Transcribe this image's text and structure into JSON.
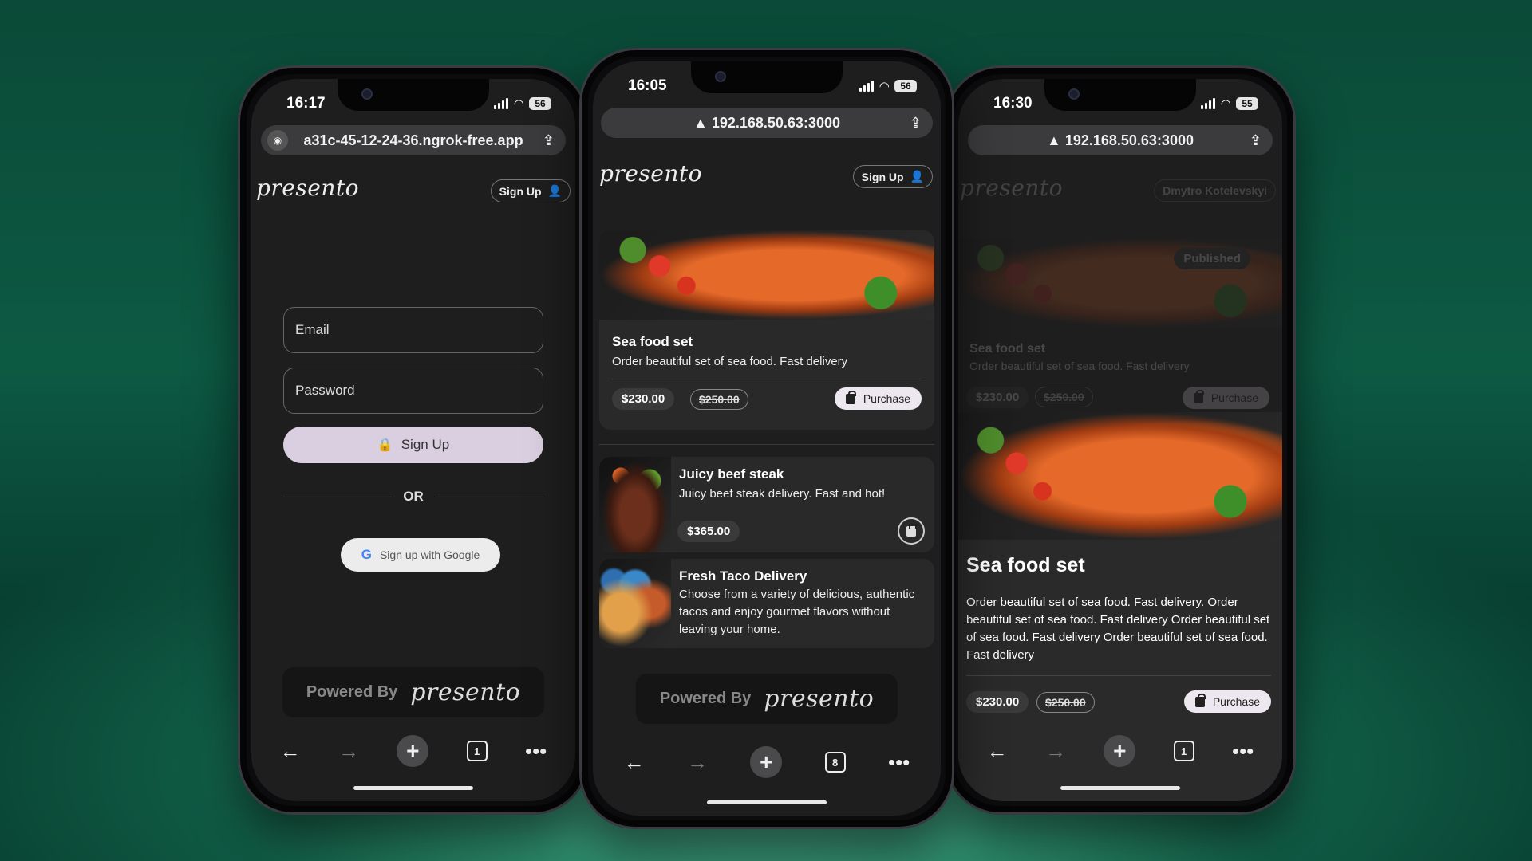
{
  "phone_left": {
    "status": {
      "time": "16:17",
      "battery": "56"
    },
    "url": "a31c-45-12-24-36.ngrok-free.app",
    "brand": "presento",
    "signup_top": "Sign Up",
    "email_placeholder": "Email",
    "password_placeholder": "Password",
    "signup_button": "Sign Up",
    "or_label": "OR",
    "google_button": "Sign up with Google",
    "powered_by": "Powered By",
    "powered_brand": "presento",
    "tab_count": "1"
  },
  "phone_center": {
    "status": {
      "time": "16:05",
      "battery": "56"
    },
    "url": "192.168.50.63:3000",
    "brand": "presento",
    "signup_top": "Sign Up",
    "featured": {
      "title": "Sea food set",
      "description": "Order beautiful set of sea food. Fast delivery",
      "price": "$230.00",
      "old_price": "$250.00",
      "purchase_label": "Purchase"
    },
    "items": [
      {
        "title": "Juicy beef steak",
        "description": "Juicy beef steak delivery. Fast and hot!",
        "price": "$365.00"
      },
      {
        "title": "Fresh Taco Delivery",
        "description": "Choose from a variety of delicious, authentic tacos and enjoy gourmet flavors without leaving your home."
      }
    ],
    "powered_by": "Powered By",
    "powered_brand": "presento",
    "tab_count": "8"
  },
  "phone_right": {
    "status": {
      "time": "16:30",
      "battery": "55"
    },
    "url": "192.168.50.63:3000",
    "background": {
      "brand": "presento",
      "user": "Dmytro Kotelevskyi",
      "badge": "Published",
      "title": "Sea food set",
      "description": "Order beautiful set of sea food. Fast delivery",
      "price": "$230.00",
      "old_price": "$250.00",
      "purchase_label": "Purchase"
    },
    "sheet": {
      "title": "Sea food set",
      "description": "Order beautiful set of sea food. Fast delivery. Order beautiful set of sea food. Fast delivery Order beautiful set of sea food. Fast delivery Order beautiful set of sea food. Fast delivery",
      "price": "$230.00",
      "old_price": "$250.00",
      "purchase_label": "Purchase"
    },
    "tab_count": "1"
  },
  "colors": {
    "accent": "#d9cfe0",
    "screen_bg": "#1f1e1e",
    "background": "#0d5a43"
  }
}
